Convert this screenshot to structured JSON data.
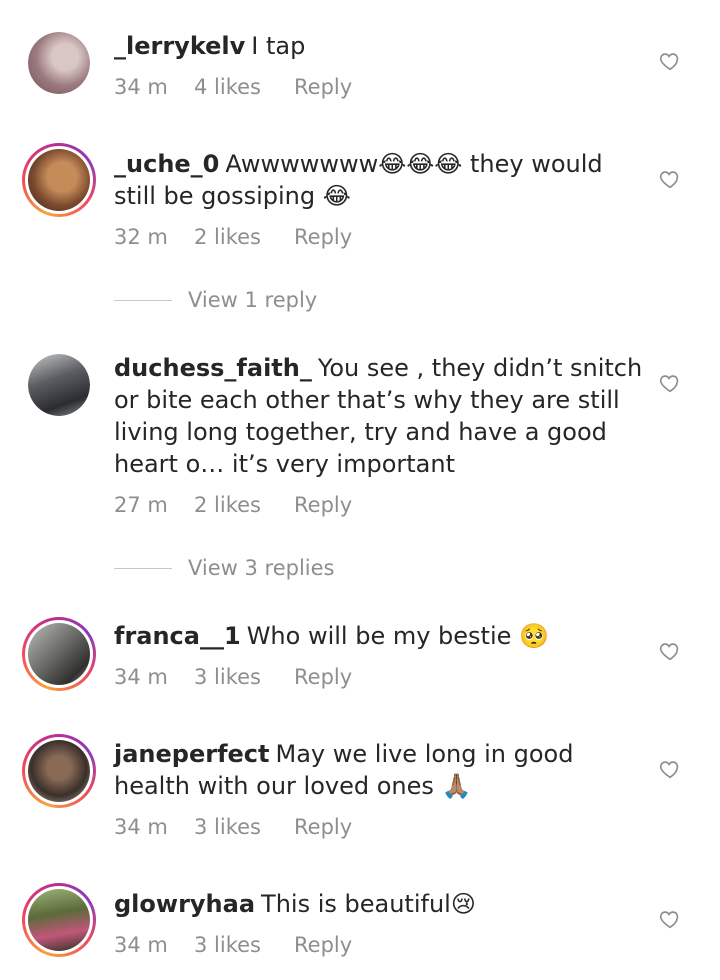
{
  "comments": [
    {
      "username": "_lerrykelv",
      "text": "I tap",
      "time": "34 m",
      "likes": "4 likes",
      "reply": "Reply",
      "ring": false,
      "avatar_color": "#a7868b"
    },
    {
      "username": "_uche_0",
      "text": "Awwwwwww😂😂😂 they would still be gossiping 😂",
      "time": "32 m",
      "likes": "2 likes",
      "reply": "Reply",
      "ring": true,
      "avatar_color": "#7a4a2e",
      "view_replies": "View 1 reply"
    },
    {
      "username": "duchess_faith_",
      "text": "You see , they didn’t snitch or bite each other that’s why they are still living long together, try and have a good heart o… it’s very important",
      "time": "27 m",
      "likes": "2 likes",
      "reply": "Reply",
      "ring": false,
      "avatar_color": "#3b3d42",
      "view_replies": "View 3 replies"
    },
    {
      "username": "franca__1",
      "text": "Who will be my bestie 🥺",
      "time": "34 m",
      "likes": "3 likes",
      "reply": "Reply",
      "ring": true,
      "avatar_color": "#6d6e6a"
    },
    {
      "username": "janeperfect",
      "text": "May we live long in good health with our loved ones 🙏🏽",
      "time": "34 m",
      "likes": "3 likes",
      "reply": "Reply",
      "ring": true,
      "avatar_color": "#3a2f2a"
    },
    {
      "username": "glowryhaa",
      "text": "This is beautiful😢",
      "time": "34 m",
      "likes": "3 likes",
      "reply": "Reply",
      "ring": true,
      "avatar_color": "#5b6b3a"
    }
  ],
  "icons": {
    "like": "heart-outline-icon"
  },
  "colors": {
    "text": "#262626",
    "meta": "#8e8e8e",
    "ring_start": "#f9a23b",
    "ring_end": "#c12d8c"
  }
}
